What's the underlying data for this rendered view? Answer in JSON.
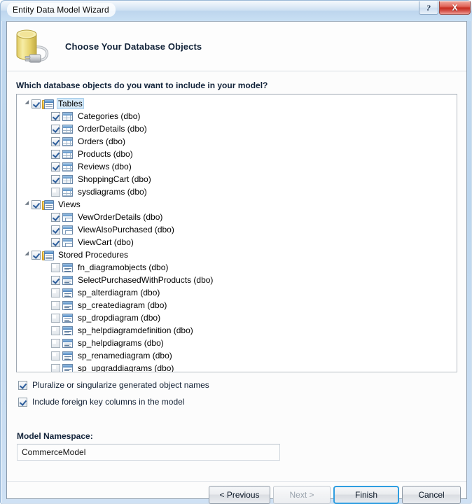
{
  "window": {
    "title": "Entity Data Model Wizard",
    "help_button_label": "?",
    "close_button_label": "X"
  },
  "header": {
    "icon": "database-plug-icon",
    "title": "Choose Your Database Objects"
  },
  "prompt": "Which database objects do you want to include in your model?",
  "tree": {
    "groups": [
      {
        "label": "Tables",
        "checked": true,
        "selected": true,
        "icon": "tables-folder-icon",
        "expanded": true,
        "items": [
          {
            "label": "Categories (dbo)",
            "checked": true,
            "icon": "table-icon"
          },
          {
            "label": "OrderDetails (dbo)",
            "checked": true,
            "icon": "table-icon"
          },
          {
            "label": "Orders (dbo)",
            "checked": true,
            "icon": "table-icon"
          },
          {
            "label": "Products (dbo)",
            "checked": true,
            "icon": "table-icon"
          },
          {
            "label": "Reviews (dbo)",
            "checked": true,
            "icon": "table-icon"
          },
          {
            "label": "ShoppingCart (dbo)",
            "checked": true,
            "icon": "table-icon"
          },
          {
            "label": "sysdiagrams (dbo)",
            "checked": false,
            "icon": "table-icon"
          }
        ]
      },
      {
        "label": "Views",
        "checked": true,
        "selected": false,
        "icon": "views-folder-icon",
        "expanded": true,
        "items": [
          {
            "label": "VewOrderDetails (dbo)",
            "checked": true,
            "icon": "view-icon"
          },
          {
            "label": "ViewAlsoPurchased (dbo)",
            "checked": true,
            "icon": "view-icon"
          },
          {
            "label": "ViewCart (dbo)",
            "checked": true,
            "icon": "view-icon"
          }
        ]
      },
      {
        "label": "Stored Procedures",
        "checked": true,
        "selected": false,
        "icon": "procedures-folder-icon",
        "expanded": true,
        "items": [
          {
            "label": "fn_diagramobjects (dbo)",
            "checked": false,
            "icon": "procedure-icon"
          },
          {
            "label": "SelectPurchasedWithProducts (dbo)",
            "checked": true,
            "icon": "procedure-icon"
          },
          {
            "label": "sp_alterdiagram (dbo)",
            "checked": false,
            "icon": "procedure-icon"
          },
          {
            "label": "sp_creatediagram (dbo)",
            "checked": false,
            "icon": "procedure-icon"
          },
          {
            "label": "sp_dropdiagram (dbo)",
            "checked": false,
            "icon": "procedure-icon"
          },
          {
            "label": "sp_helpdiagramdefinition (dbo)",
            "checked": false,
            "icon": "procedure-icon"
          },
          {
            "label": "sp_helpdiagrams (dbo)",
            "checked": false,
            "icon": "procedure-icon"
          },
          {
            "label": "sp_renamediagram (dbo)",
            "checked": false,
            "icon": "procedure-icon"
          },
          {
            "label": "sp_upgraddiagrams (dbo)",
            "checked": false,
            "icon": "procedure-icon"
          }
        ]
      }
    ]
  },
  "options": [
    {
      "label": "Pluralize or singularize generated object names",
      "checked": true
    },
    {
      "label": "Include foreign key columns in the model",
      "checked": true
    }
  ],
  "namespace": {
    "label": "Model Namespace:",
    "value": "CommerceModel",
    "placeholder": ""
  },
  "buttons": {
    "previous": "< Previous",
    "next": "Next >",
    "finish": "Finish",
    "cancel": "Cancel"
  },
  "colors": {
    "accent": "#2e9de0",
    "close": "#c62d1f",
    "selection": "#d6eaf9",
    "frame": "#c3d9ef"
  }
}
